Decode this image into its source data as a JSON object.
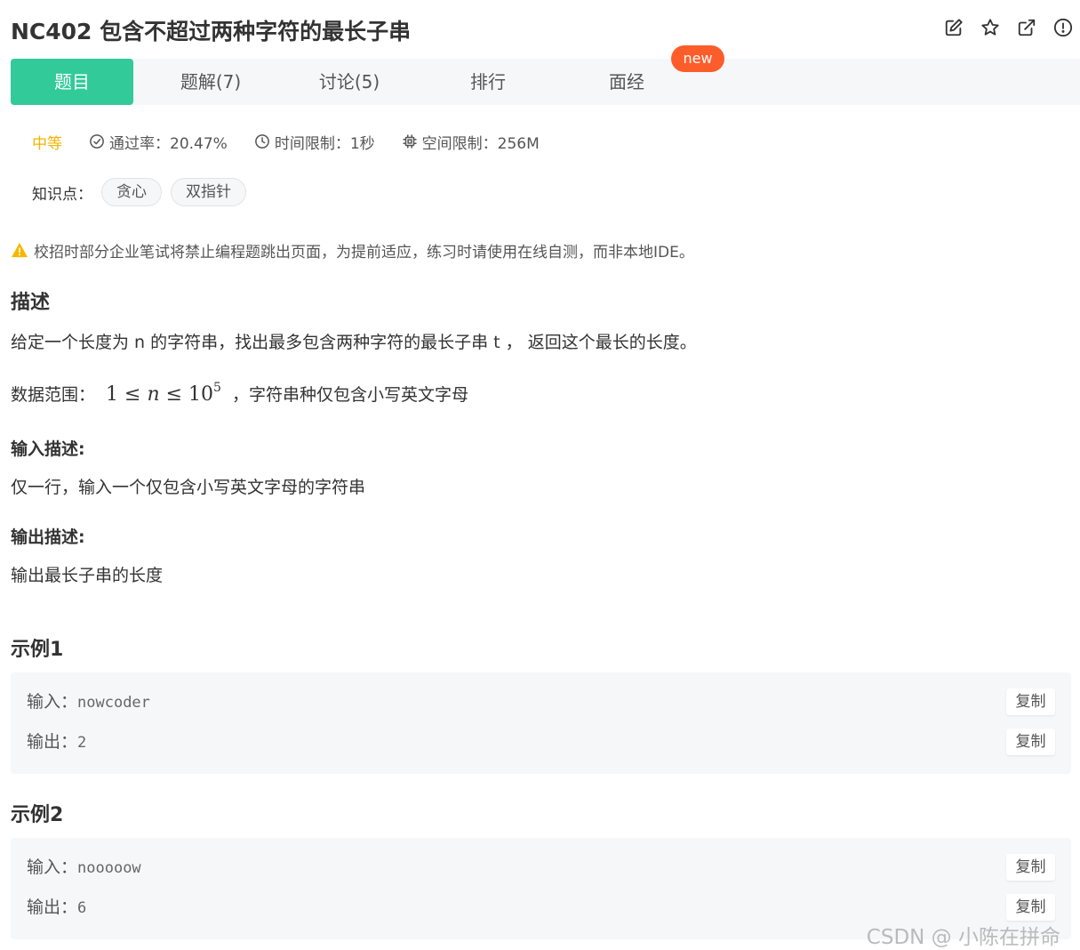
{
  "problem": {
    "title": "NC402  包含不超过两种字符的最长子串"
  },
  "header_icons": [
    "edit-icon",
    "star-icon",
    "external-link-icon",
    "alert-circle-icon"
  ],
  "tabs": [
    {
      "label": "题目",
      "active": true
    },
    {
      "label": "题解(7)",
      "active": false
    },
    {
      "label": "讨论(5)",
      "active": false
    },
    {
      "label": "排行",
      "active": false
    },
    {
      "label": "面经",
      "active": false
    }
  ],
  "new_badge": "new",
  "meta": {
    "difficulty": "中等",
    "pass_rate": "通过率：20.47%",
    "time_limit": "时间限制：1秒",
    "space_limit": "空间限制：256M"
  },
  "knowledge": {
    "label": "知识点：",
    "tags": [
      "贪心",
      "双指针"
    ]
  },
  "warning": "校招时部分企业笔试将禁止编程题跳出页面，为提前适应，练习时请使用在线自测，而非本地IDE。",
  "description": {
    "heading": "描述",
    "text": "给定一个长度为 n 的字符串，找出最多包含两种字符的最长子串 t ， 返回这个最长的长度。",
    "range_label": "数据范围：",
    "range_math": {
      "lhs": "1",
      "var": "n",
      "base": "10",
      "exp": "5"
    },
    "range_tail": "，字符串种仅包含小写英文字母"
  },
  "input_desc": {
    "heading": "输入描述:",
    "text": "仅一行，输入一个仅包含小写英文字母的字符串"
  },
  "output_desc": {
    "heading": "输出描述:",
    "text": "输出最长子串的长度"
  },
  "examples": [
    {
      "heading": "示例1",
      "input_label": "输入：",
      "input": "nowcoder",
      "output_label": "输出：",
      "output": "2",
      "copy": "复制"
    },
    {
      "heading": "示例2",
      "input_label": "输入：",
      "input": "nooooow",
      "output_label": "输出：",
      "output": "6",
      "copy": "复制"
    }
  ],
  "watermark": "CSDN @ 小陈在拼命",
  "colors": {
    "accent": "#32ca99",
    "badge": "#fd5d2a",
    "difficulty": "#f4b400",
    "warning": "#f5b800"
  }
}
